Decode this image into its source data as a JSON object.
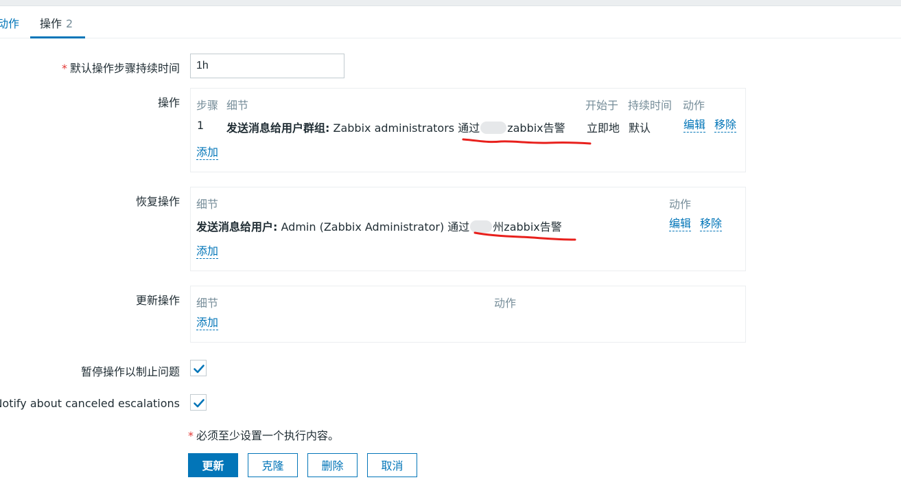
{
  "tabs": [
    {
      "label": "动作"
    },
    {
      "label": "操作",
      "count": "2"
    }
  ],
  "form": {
    "duration_label": "默认操作步骤持续时间",
    "duration_value": "1h",
    "operations_label": "操作",
    "recovery_label": "恢复操作",
    "update_label": "更新操作",
    "pause_label": "暂停操作以制止问题",
    "notify_label": "Notify about canceled escalations",
    "required_mark": "*"
  },
  "operations": {
    "headers": {
      "steps": "步骤",
      "details": "细节",
      "start_in": "开始于",
      "duration": "持续时间",
      "action": "动作"
    },
    "rows": [
      {
        "step": "1",
        "detail_bold": "发送消息给用户群组:",
        "detail_text": " Zabbix administrators 通过",
        "detail_suffix": "zabbix告警",
        "start_in": "立即地",
        "duration": "默认",
        "edit": "编辑",
        "remove": "移除"
      }
    ],
    "add": "添加"
  },
  "recovery": {
    "headers": {
      "details": "细节",
      "action": "动作"
    },
    "rows": [
      {
        "detail_bold": "发送消息给用户:",
        "detail_text": " Admin (Zabbix Administrator) 通过",
        "detail_suffix": "州zabbix告警",
        "edit": "编辑",
        "remove": "移除"
      }
    ],
    "add": "添加"
  },
  "update": {
    "headers": {
      "details": "细节",
      "action": "动作"
    },
    "add": "添加"
  },
  "checkboxes": {
    "pause_checked": true,
    "notify_checked": true
  },
  "note": {
    "mark": "*",
    "text": "必须至少设置一个执行内容。"
  },
  "buttons": {
    "update": "更新",
    "clone": "克隆",
    "delete": "删除",
    "cancel": "取消"
  },
  "colors": {
    "accent": "#0275b8",
    "required": "#e33734",
    "annotation": "#e8201c"
  }
}
